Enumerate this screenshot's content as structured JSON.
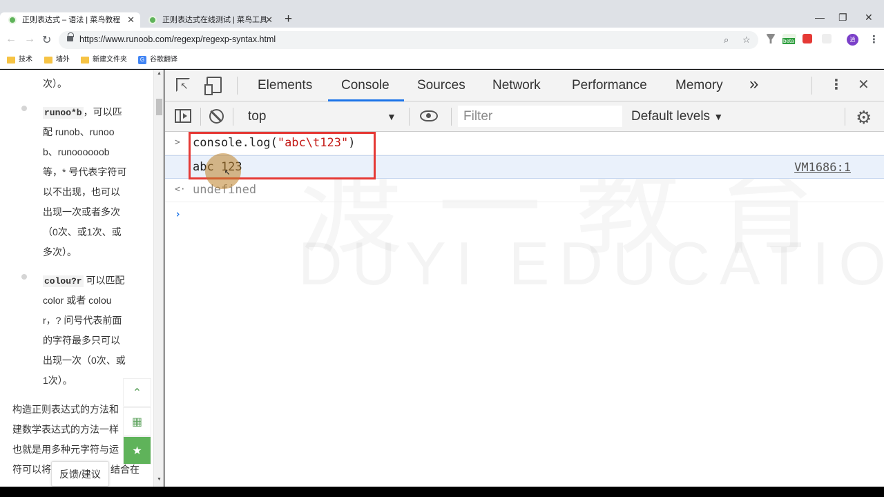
{
  "browser": {
    "tabs": [
      {
        "title": "正则表达式 – 语法 | 菜鸟教程",
        "active": true
      },
      {
        "title": "正则表达式在线测试 | 菜鸟工具",
        "active": false
      }
    ],
    "url": "https://www.runoob.com/regexp/regexp-syntax.html",
    "bookmarks": [
      "技术",
      "墙外",
      "新建文件夹",
      "谷歌翻译"
    ],
    "profile_initial": "逍",
    "ext_beta_label": "beta"
  },
  "page": {
    "lines": [
      "次）。",
      "，可以匹",
      "配 runob、runoo",
      "b、runoooooob",
      "等，* 号代表字符可",
      "以不出现，也可以",
      "出现一次或者多次",
      "（0次、或1次、或",
      "多次）。",
      "可以匹配",
      "color 或者 colou",
      "r，? 问号代表前面",
      "的字符最多只可以",
      "出现一次（0次、或",
      "1次）。",
      "构造正则表达式的方法和",
      "建数学表达式的方法一样",
      "也就是用多种元字符与运",
      "符可以将",
      "结合在"
    ],
    "code1": "runoo*b",
    "code2": "colou?r",
    "feedback": "反馈/建议"
  },
  "devtools": {
    "tabs": [
      "Elements",
      "Console",
      "Sources",
      "Network",
      "Performance",
      "Memory"
    ],
    "active_tab": "Console",
    "more": "»",
    "context": "top",
    "filter_placeholder": "Filter",
    "levels": "Default levels",
    "console": {
      "input_prefix": "console.log(",
      "input_string": "\"abc\\t123\"",
      "input_suffix": ")",
      "output": "abc 123",
      "source": "VM1686:1",
      "return_value": "undefined"
    }
  },
  "watermark": {
    "cn": "渡一教育",
    "en": "DUYI EDUCATION"
  },
  "colors": {
    "accent": "#1a73e8",
    "highlight": "#e53935",
    "string": "#c41a16",
    "site_green": "#5fb35a"
  }
}
